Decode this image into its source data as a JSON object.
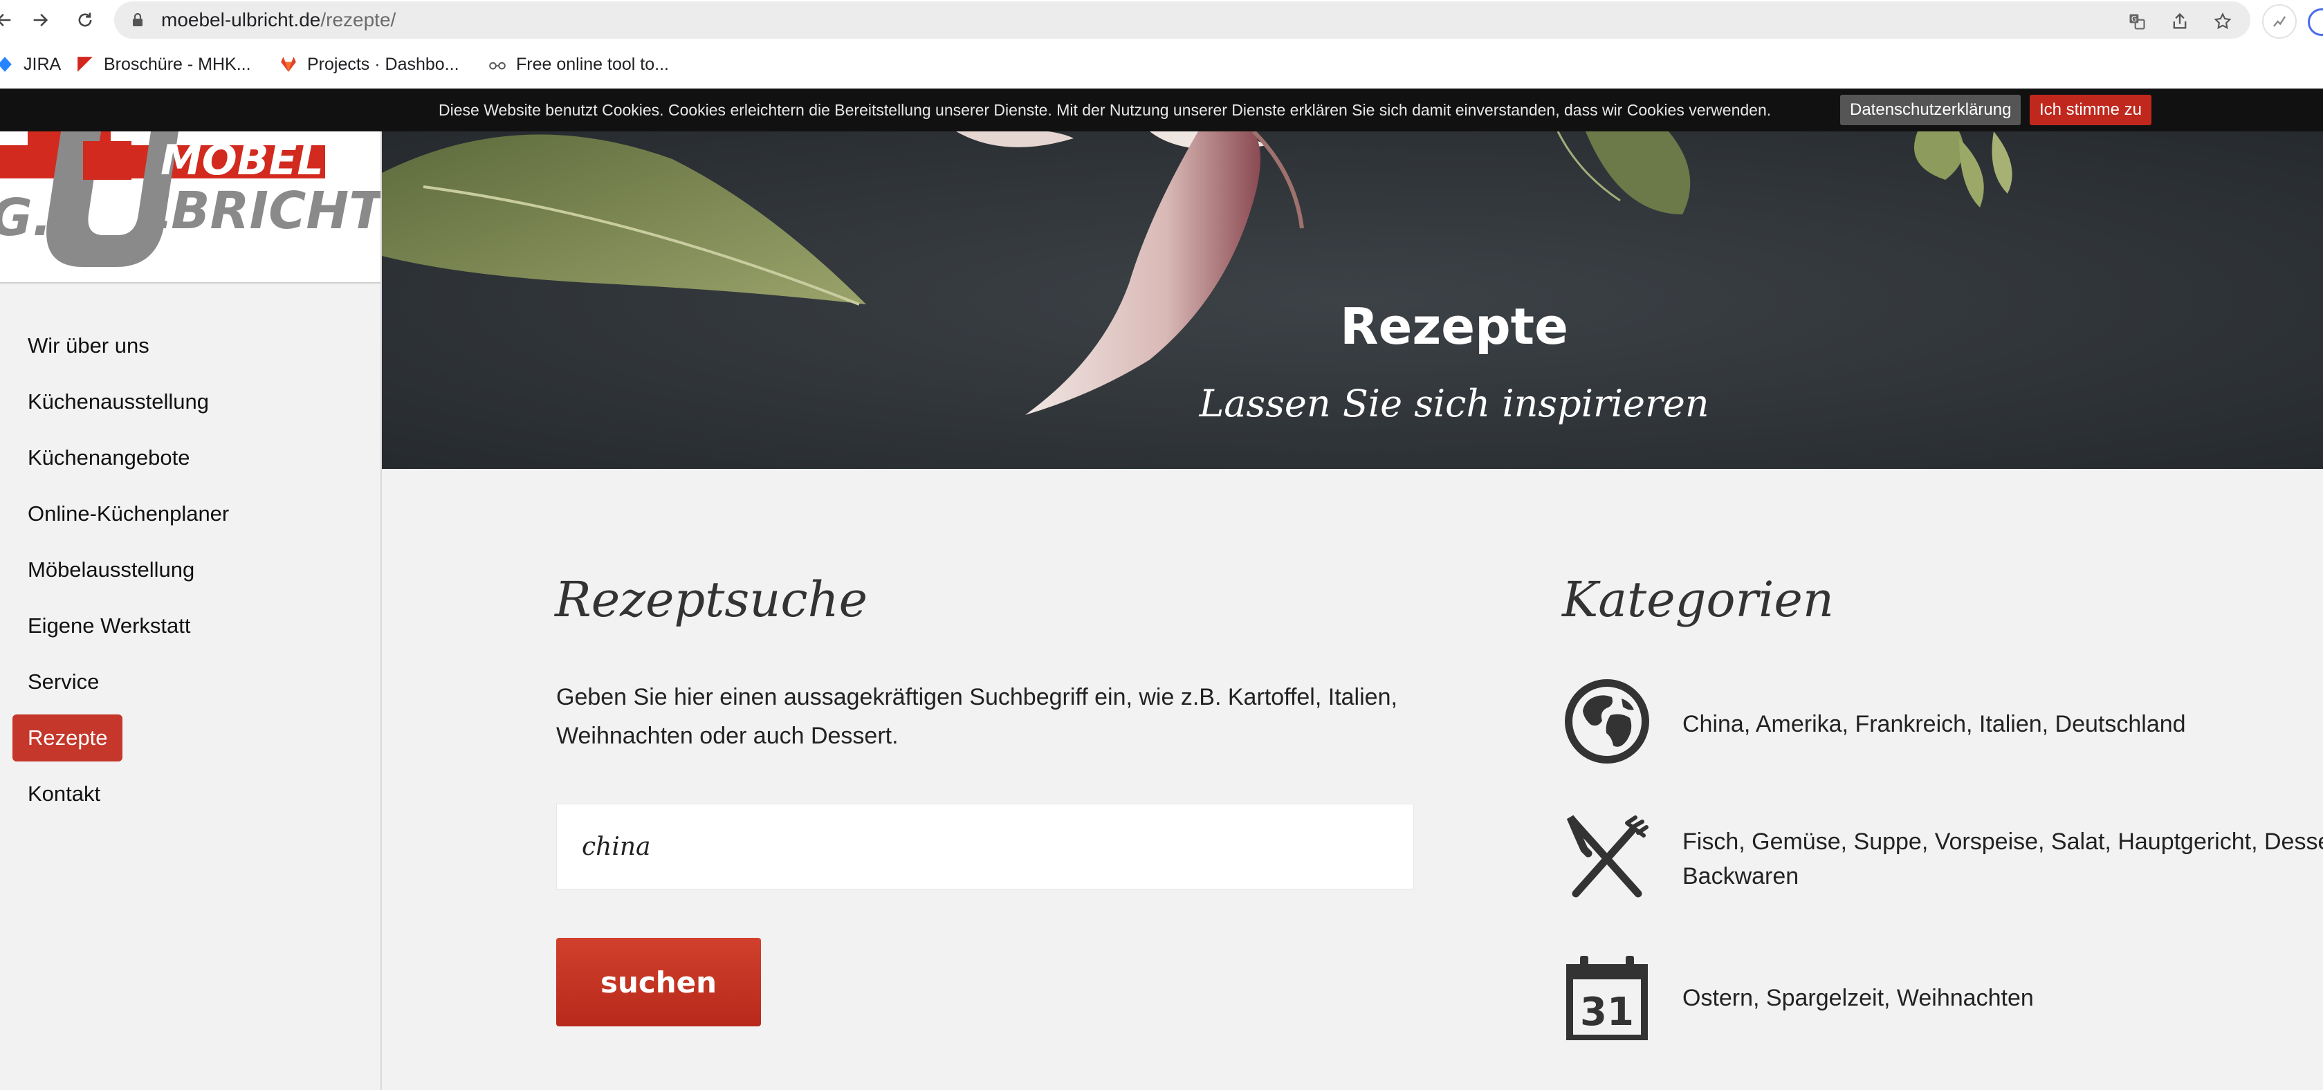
{
  "browser": {
    "url_domain": "moebel-ulbricht.de",
    "url_path": "/rezepte/",
    "bookmarks": [
      {
        "label": "JIRA"
      },
      {
        "label": "Broschüre - MHK..."
      },
      {
        "label": "Projects · Dashbo..."
      },
      {
        "label": "Free online tool to..."
      }
    ]
  },
  "cookie_bar": {
    "text": "Diese Website benutzt Cookies. Cookies erleichtern die Bereitstellung unserer Dienste. Mit der Nutzung unserer Dienste erklären Sie sich damit einverstanden, dass wir Cookies verwenden.",
    "privacy_label": "Datenschutzerklärung",
    "agree_label": "Ich stimme zu"
  },
  "logo": {
    "line1": "MÖBEL",
    "line2": "G.",
    "line3": "LBRICHT"
  },
  "sidebar": {
    "items": [
      {
        "label": "Wir über uns",
        "active": false
      },
      {
        "label": "Küchenausstellung",
        "active": false
      },
      {
        "label": "Küchenangebote",
        "active": false
      },
      {
        "label": "Online-Küchenplaner",
        "active": false
      },
      {
        "label": "Möbelausstellung",
        "active": false
      },
      {
        "label": "Eigene Werkstatt",
        "active": false
      },
      {
        "label": "Service",
        "active": false
      },
      {
        "label": "Rezepte",
        "active": true
      },
      {
        "label": "Kontakt",
        "active": false
      }
    ]
  },
  "hero": {
    "title": "Rezepte",
    "subtitle": "Lassen Sie sich inspirieren"
  },
  "search": {
    "heading": "Rezeptsuche",
    "description": "Geben Sie hier einen aussagekräftigen Suchbegriff ein, wie z.B. Kartoffel, Italien, Weihnachten oder auch Dessert.",
    "value": "china",
    "button_label": "suchen"
  },
  "categories": {
    "heading": "Kategorien",
    "items": [
      {
        "icon": "globe-icon",
        "text": "China, Amerika, Frankreich, Italien, Deutschland"
      },
      {
        "icon": "fork-knife-icon",
        "text_line1": "Fisch, Gemüse, Suppe, Vorspeise, Salat, Hauptgericht, Dessert,",
        "text_line2": "Backwaren"
      },
      {
        "icon": "calendar-icon",
        "calendar_day": "31",
        "text": "Ostern, Spargelzeit, Weihnachten"
      }
    ]
  },
  "colors": {
    "accent": "#c4372a",
    "cookie_bar": "#111111"
  }
}
